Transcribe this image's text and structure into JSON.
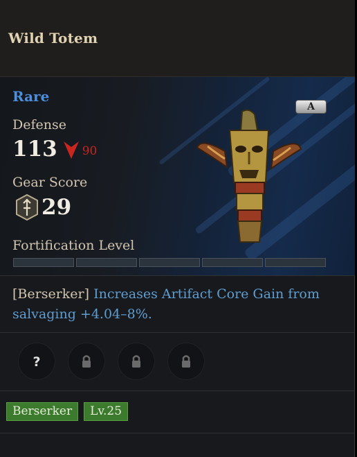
{
  "item": {
    "name": "Wild Totem",
    "rarity": "Rare",
    "rarity_color": "#4c8fdc",
    "grade_badge": "A",
    "defense": {
      "label": "Defense",
      "value": "113",
      "compare_icon": "down-arrow-icon",
      "compare_value": "90",
      "compare_color": "#c8261f"
    },
    "gear_score": {
      "label": "Gear Score",
      "icon": "gear-score-shield-icon",
      "value": "29"
    },
    "fortification": {
      "label": "Fortification Level",
      "segments_total": 5,
      "segments_filled": 0
    },
    "effect": {
      "prefix": "[Berserker]",
      "text": "Increases Artifact Core Gain from salvaging +4.04–8%."
    },
    "sockets": [
      {
        "icon": "question-mark-icon",
        "state": "unknown"
      },
      {
        "icon": "lock-icon",
        "state": "locked"
      },
      {
        "icon": "lock-icon",
        "state": "locked"
      },
      {
        "icon": "lock-icon",
        "state": "locked"
      }
    ],
    "tags": [
      "Berserker",
      "Lv.25"
    ]
  }
}
